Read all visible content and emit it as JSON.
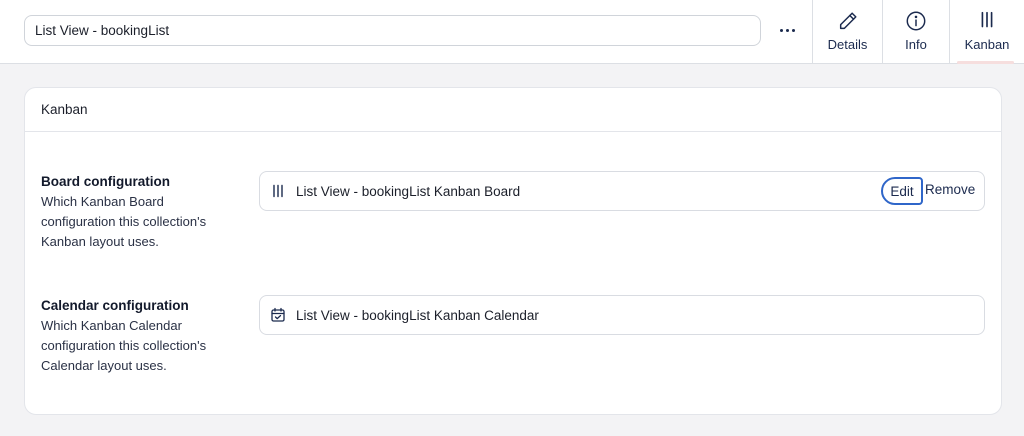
{
  "header": {
    "view_name": "List View - bookingList",
    "more_icon": "ellipsis-icon",
    "tabs": [
      {
        "label": "Details",
        "icon": "pencil-icon"
      },
      {
        "label": "Info",
        "icon": "info-icon"
      },
      {
        "label": "Kanban",
        "icon": "kanban-columns-icon",
        "active": true
      }
    ]
  },
  "card": {
    "title": "Kanban",
    "board": {
      "title": "Board configuration",
      "description": "Which Kanban Board configuration this collection's Kanban layout uses.",
      "value": "List View - bookingList Kanban Board",
      "icon": "kanban-columns-icon",
      "edit_label": "Edit",
      "remove_label": "Remove"
    },
    "calendar": {
      "title": "Calendar configuration",
      "description": "Which Kanban Calendar configuration this collection's Calendar layout uses.",
      "value": "List View - bookingList Kanban Calendar",
      "icon": "calendar-icon"
    }
  },
  "colors": {
    "accent": "#2f66c9",
    "text": "#1b2a4e",
    "active_tab_underline": "#f6dede",
    "background": "#f3f3f5"
  }
}
